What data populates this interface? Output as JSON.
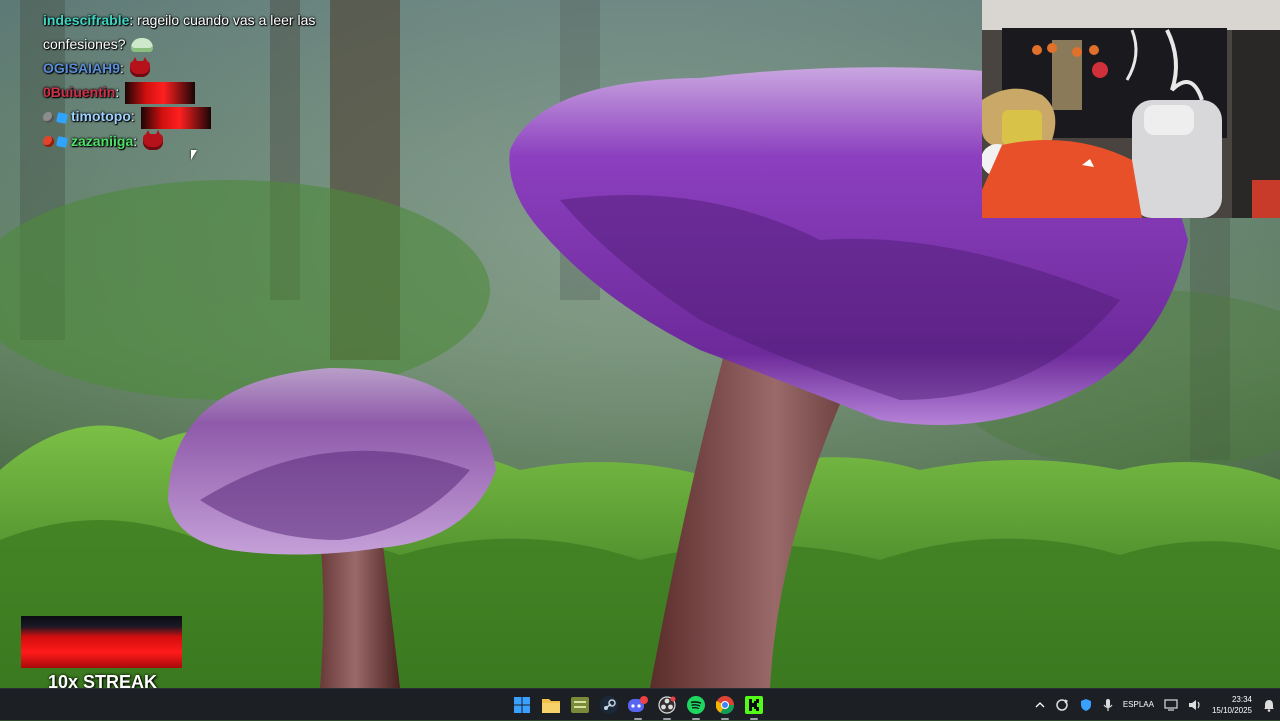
{
  "chat": {
    "messages": [
      {
        "user": "indescifrable",
        "user_color": "#3fd6c4",
        "text": " rageilo cuando vas a leer las",
        "emote": "frog-emote"
      },
      {
        "user": "",
        "text": "confesiones?",
        "emote": "frog-emote"
      },
      {
        "user": "OGISAIAH9",
        "user_color": "#5b8fd9",
        "emote": "devil-emote"
      },
      {
        "user": "0Buiuentin",
        "user_color": "#d0304a",
        "emote": "red-wide-emote"
      },
      {
        "user": "timotopo",
        "user_color": "#9ed1ff",
        "emote": "red-wide-emote"
      },
      {
        "user": "zazaniiga",
        "user_color": "#4fe06a",
        "emote": "devil-emote"
      }
    ],
    "separator": ":"
  },
  "streak": {
    "label": "10x STREAK"
  },
  "taskbar": {
    "apps": [
      {
        "name": "windows-start",
        "icon": "windows-icon"
      },
      {
        "name": "file-explorer",
        "icon": "folder-icon"
      },
      {
        "name": "app-green",
        "icon": "app-icon"
      },
      {
        "name": "steam",
        "icon": "steam-icon"
      },
      {
        "name": "discord",
        "icon": "discord-icon",
        "badge": "9+"
      },
      {
        "name": "obs",
        "icon": "obs-icon"
      },
      {
        "name": "spotify",
        "icon": "spotify-icon"
      },
      {
        "name": "chrome",
        "icon": "chrome-icon"
      },
      {
        "name": "kick",
        "icon": "kick-icon"
      }
    ],
    "tray": {
      "lang_top": "ESP",
      "lang_bottom": "LAA",
      "time": "23:34",
      "date": "15/10/2025"
    }
  },
  "colors": {
    "taskbar_bg": "#1c1f24",
    "mushroom_cap": "#8a4fbf",
    "moss": "#4f9a2c"
  }
}
